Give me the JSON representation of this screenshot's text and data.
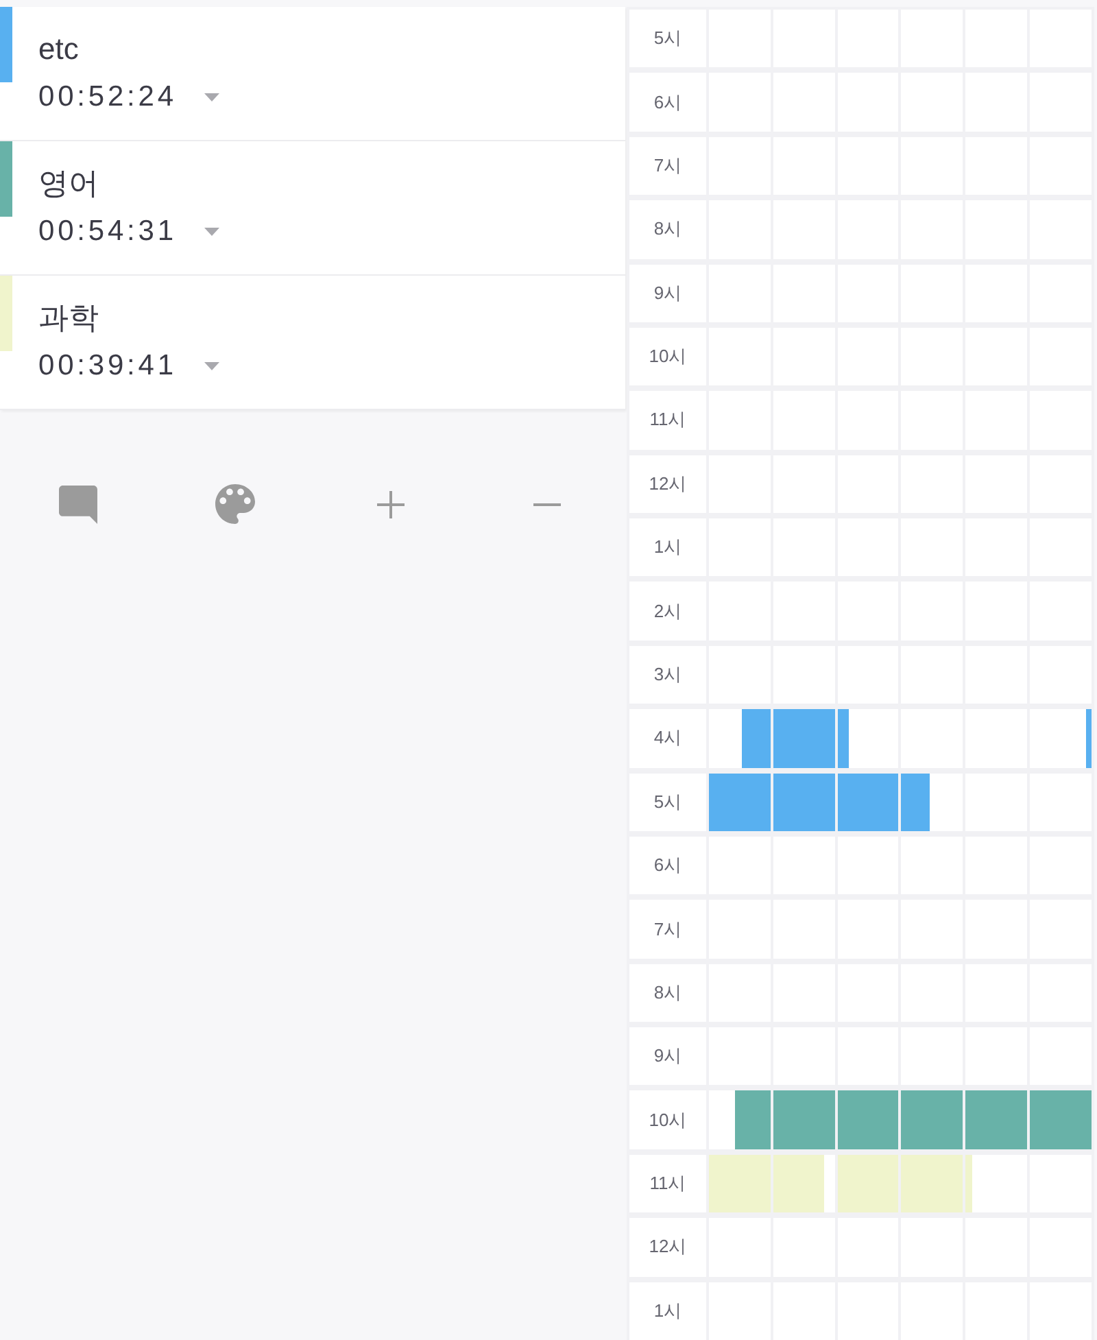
{
  "subjects": [
    {
      "name": "etc",
      "time": "00:52:24",
      "color": "#58b0f0"
    },
    {
      "name": "영어",
      "time": "00:54:31",
      "color": "#68b2a8"
    },
    {
      "name": "과학",
      "time": "00:39:41",
      "color": "#f0f4cc"
    }
  ],
  "timetable": {
    "rows": [
      {
        "hour": "5시",
        "cells": [
          {
            "filled": false
          },
          {
            "filled": false
          },
          {
            "filled": false
          },
          {
            "filled": false
          },
          {
            "filled": false
          },
          {
            "filled": false
          }
        ]
      },
      {
        "hour": "6시",
        "cells": [
          {
            "filled": false
          },
          {
            "filled": false
          },
          {
            "filled": false
          },
          {
            "filled": false
          },
          {
            "filled": false
          },
          {
            "filled": false
          }
        ]
      },
      {
        "hour": "7시",
        "cells": [
          {
            "filled": false
          },
          {
            "filled": false
          },
          {
            "filled": false
          },
          {
            "filled": false
          },
          {
            "filled": false
          },
          {
            "filled": false
          }
        ]
      },
      {
        "hour": "8시",
        "cells": [
          {
            "filled": false
          },
          {
            "filled": false
          },
          {
            "filled": false
          },
          {
            "filled": false
          },
          {
            "filled": false
          },
          {
            "filled": false
          }
        ]
      },
      {
        "hour": "9시",
        "cells": [
          {
            "filled": false
          },
          {
            "filled": false
          },
          {
            "filled": false
          },
          {
            "filled": false
          },
          {
            "filled": false
          },
          {
            "filled": false
          }
        ]
      },
      {
        "hour": "10시",
        "cells": [
          {
            "filled": false
          },
          {
            "filled": false
          },
          {
            "filled": false
          },
          {
            "filled": false
          },
          {
            "filled": false
          },
          {
            "filled": false
          }
        ]
      },
      {
        "hour": "11시",
        "cells": [
          {
            "filled": false
          },
          {
            "filled": false
          },
          {
            "filled": false
          },
          {
            "filled": false
          },
          {
            "filled": false
          },
          {
            "filled": false
          }
        ]
      },
      {
        "hour": "12시",
        "cells": [
          {
            "filled": false
          },
          {
            "filled": false
          },
          {
            "filled": false
          },
          {
            "filled": false
          },
          {
            "filled": false
          },
          {
            "filled": false
          }
        ]
      },
      {
        "hour": "1시",
        "cells": [
          {
            "filled": false
          },
          {
            "filled": false
          },
          {
            "filled": false
          },
          {
            "filled": false
          },
          {
            "filled": false
          },
          {
            "filled": false
          }
        ]
      },
      {
        "hour": "2시",
        "cells": [
          {
            "filled": false
          },
          {
            "filled": false
          },
          {
            "filled": false
          },
          {
            "filled": false
          },
          {
            "filled": false
          },
          {
            "filled": false
          }
        ]
      },
      {
        "hour": "3시",
        "cells": [
          {
            "filled": false
          },
          {
            "filled": false
          },
          {
            "filled": false
          },
          {
            "filled": false
          },
          {
            "filled": false
          },
          {
            "filled": false
          }
        ]
      },
      {
        "hour": "4시",
        "cells": [
          {
            "filled": true,
            "level": 0.47,
            "from_end": true,
            "color": "#58b0f0"
          },
          {
            "filled": true,
            "color": "#58b0f0"
          },
          {
            "filled": true,
            "level": 0.18,
            "from_end": false,
            "color": "#58b0f0"
          },
          {
            "filled": false
          },
          {
            "filled": false
          },
          {
            "filled": true,
            "level": 0.09,
            "from_end": true,
            "color": "#58b0f0"
          }
        ]
      },
      {
        "hour": "5시",
        "cells": [
          {
            "filled": true,
            "color": "#58b0f0"
          },
          {
            "filled": true,
            "color": "#58b0f0"
          },
          {
            "filled": true,
            "color": "#58b0f0"
          },
          {
            "filled": true,
            "level": 0.45,
            "from_end": false,
            "color": "#58b0f0"
          },
          {
            "filled": false
          },
          {
            "filled": false
          }
        ]
      },
      {
        "hour": "6시",
        "cells": [
          {
            "filled": false
          },
          {
            "filled": false
          },
          {
            "filled": false
          },
          {
            "filled": false
          },
          {
            "filled": false
          },
          {
            "filled": false
          }
        ]
      },
      {
        "hour": "7시",
        "cells": [
          {
            "filled": false
          },
          {
            "filled": false
          },
          {
            "filled": false
          },
          {
            "filled": false
          },
          {
            "filled": false
          },
          {
            "filled": false
          }
        ]
      },
      {
        "hour": "8시",
        "cells": [
          {
            "filled": false
          },
          {
            "filled": false
          },
          {
            "filled": false
          },
          {
            "filled": false
          },
          {
            "filled": false
          },
          {
            "filled": false
          }
        ]
      },
      {
        "hour": "9시",
        "cells": [
          {
            "filled": false
          },
          {
            "filled": false
          },
          {
            "filled": false
          },
          {
            "filled": false
          },
          {
            "filled": false
          },
          {
            "filled": false
          }
        ]
      },
      {
        "hour": "10시",
        "cells": [
          {
            "filled": true,
            "level": 0.58,
            "from_end": true,
            "color": "#68b2a8"
          },
          {
            "filled": true,
            "color": "#68b2a8"
          },
          {
            "filled": true,
            "color": "#68b2a8"
          },
          {
            "filled": true,
            "color": "#68b2a8"
          },
          {
            "filled": true,
            "color": "#68b2a8"
          },
          {
            "filled": true,
            "color": "#68b2a8"
          }
        ]
      },
      {
        "hour": "11시",
        "cells": [
          {
            "filled": true,
            "color": "#f0f4cc"
          },
          {
            "filled": true,
            "level": 0.84,
            "from_end": false,
            "color": "#f0f4cc"
          },
          {
            "filled": true,
            "color": "#f0f4cc"
          },
          {
            "filled": true,
            "color": "#f0f4cc"
          },
          {
            "filled": true,
            "level": 0.1,
            "from_end": false,
            "color": "#f0f4cc"
          },
          {
            "filled": false
          }
        ]
      },
      {
        "hour": "12시",
        "cells": [
          {
            "filled": false
          },
          {
            "filled": false
          },
          {
            "filled": false
          },
          {
            "filled": false
          },
          {
            "filled": false
          },
          {
            "filled": false
          }
        ]
      },
      {
        "hour": "1시",
        "cells": [
          {
            "filled": false
          },
          {
            "filled": false
          },
          {
            "filled": false
          },
          {
            "filled": false
          },
          {
            "filled": false
          },
          {
            "filled": false
          }
        ]
      }
    ]
  }
}
